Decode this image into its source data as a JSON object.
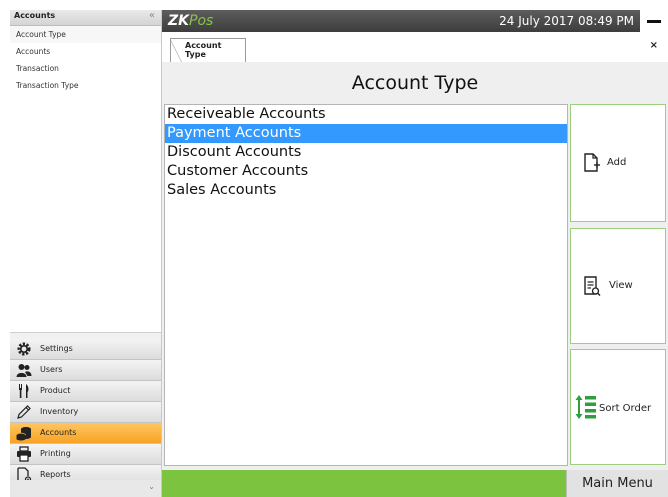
{
  "sidebar": {
    "title": "Accounts",
    "collapse_glyph": "«",
    "items": [
      {
        "label": "Account Type"
      },
      {
        "label": "Accounts"
      },
      {
        "label": "Transaction"
      },
      {
        "label": "Transaction Type"
      }
    ],
    "modules": [
      {
        "label": "Settings",
        "icon": "gear-icon"
      },
      {
        "label": "Users",
        "icon": "users-icon"
      },
      {
        "label": "Product",
        "icon": "fork-knife-icon"
      },
      {
        "label": "Inventory",
        "icon": "pencil-icon"
      },
      {
        "label": "Accounts",
        "icon": "coins-icon",
        "active": true
      },
      {
        "label": "Printing",
        "icon": "printer-icon"
      },
      {
        "label": "Reports",
        "icon": "report-icon"
      }
    ],
    "active_color": "#f7a324"
  },
  "topbar": {
    "logo_zk": "ZK",
    "logo_pos": "Pos",
    "datetime": "24 July 2017 08:49 PM"
  },
  "tab": {
    "label_line1": "Account",
    "label_line2": "Type",
    "close_glyph": "×"
  },
  "main": {
    "title": "Account Type",
    "accounts": [
      {
        "label": "Receiveable Accounts"
      },
      {
        "label": "Payment Accounts",
        "selected": true
      },
      {
        "label": "Discount Accounts"
      },
      {
        "label": "Customer Accounts"
      },
      {
        "label": "Sales Accounts"
      }
    ],
    "selection_color": "#3399ff",
    "actions": {
      "add_label": "Add",
      "view_label": "View",
      "sort_label": "Sort Order"
    }
  },
  "footer": {
    "main_menu_label": "Main Menu",
    "accent_color": "#7cc340"
  }
}
